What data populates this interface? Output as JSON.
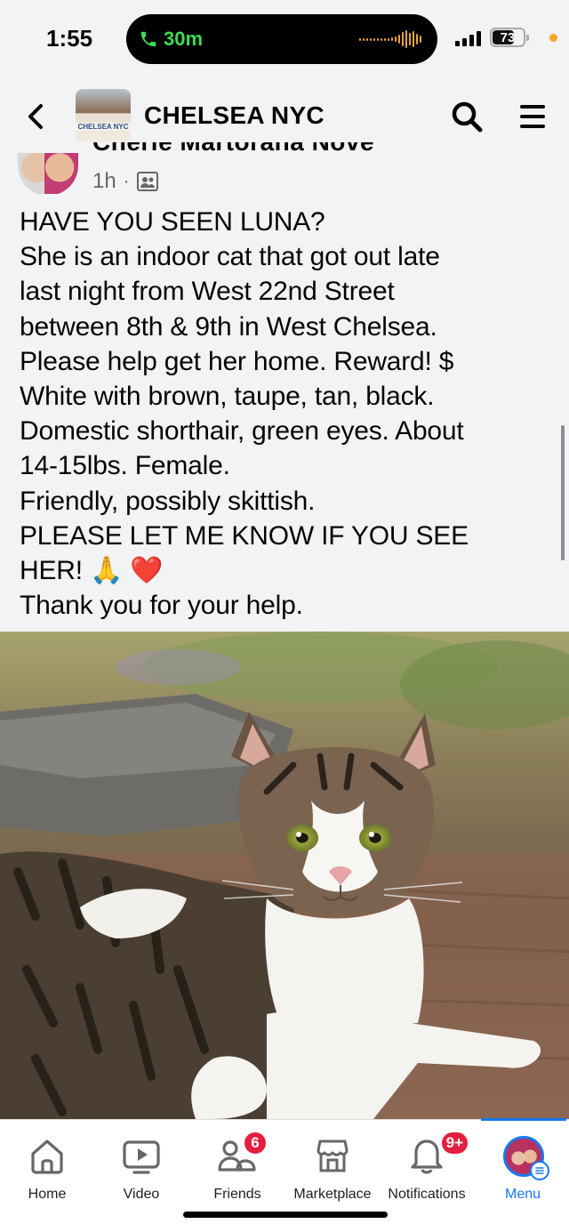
{
  "status_bar": {
    "time": "1:55",
    "call_duration": "30m",
    "battery_percent": "73",
    "battery_level": 0.73
  },
  "header": {
    "title": "CHELSEA NYC",
    "group_thumb_text": "CHELSEA NYC",
    "back_icon": "chevron-left-icon",
    "search_icon": "search-icon",
    "menu_icon": "hamburger-icon"
  },
  "post": {
    "author_name_partial": "Cherie Martorana Nove",
    "time_ago": "1h",
    "separator": "·",
    "audience_icon": "group-members-icon",
    "lines": [
      "HAVE YOU SEEN LUNA?",
      "She is an indoor cat that got out late",
      "last night from West 22nd Street",
      "between 8th & 9th in West Chelsea.",
      "Please help get her home.  Reward! $",
      "White with brown, taupe, tan, black.",
      "Domestic shorthair, green eyes.  About",
      "14-15lbs.  Female.",
      "Friendly, possibly skittish.",
      "PLEASE LET ME KNOW IF YOU SEE",
      "HER! 🙏 ❤️",
      "Thank you for your help."
    ],
    "photo_icon": "cat-photo"
  },
  "tabbar": {
    "tabs": [
      {
        "label": "Home",
        "icon": "home-icon"
      },
      {
        "label": "Video",
        "icon": "video-icon"
      },
      {
        "label": "Friends",
        "icon": "friends-icon",
        "badge": "6"
      },
      {
        "label": "Marketplace",
        "icon": "marketplace-icon"
      },
      {
        "label": "Notifications",
        "icon": "bell-icon",
        "badge": "9+"
      },
      {
        "label": "Menu",
        "icon": "profile-avatar",
        "active": true
      }
    ],
    "accent_color": "#1877f2",
    "badge_color": "#e41e3f"
  }
}
